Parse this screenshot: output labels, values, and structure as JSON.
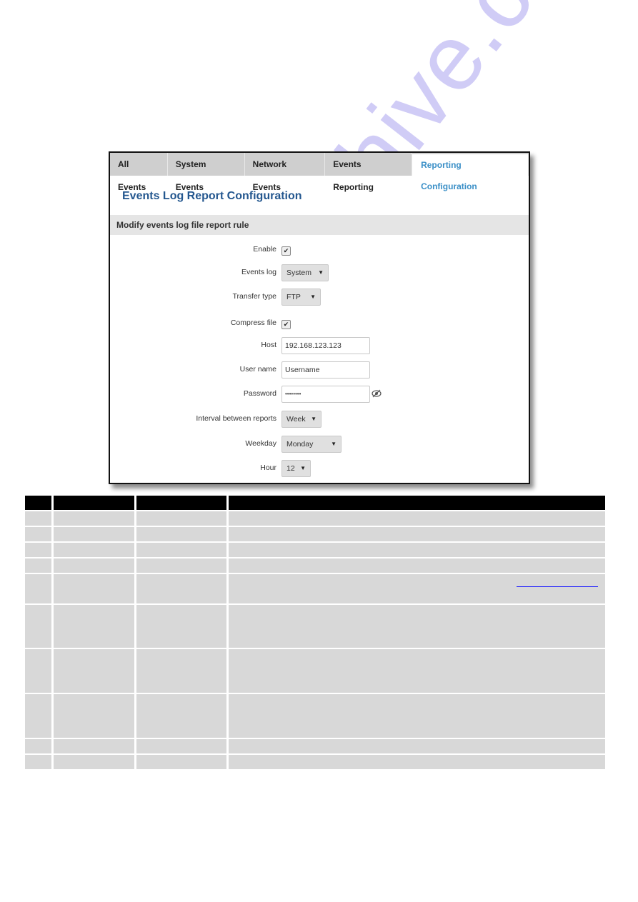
{
  "tabs": [
    {
      "label": "All Events",
      "active": false
    },
    {
      "label": "System Events",
      "active": false
    },
    {
      "label": "Network Events",
      "active": false
    },
    {
      "label": "Events Reporting",
      "active": false
    },
    {
      "label": "Reporting Configuration",
      "active": true
    }
  ],
  "page_title": "Events Log Report Configuration",
  "section_title": "Modify events log file report rule",
  "form": {
    "enable": {
      "label": "Enable",
      "checked": true
    },
    "events_log": {
      "label": "Events log",
      "value": "System"
    },
    "transfer_type": {
      "label": "Transfer type",
      "value": "FTP"
    },
    "compress_file": {
      "label": "Compress file",
      "checked": true
    },
    "host": {
      "label": "Host",
      "value": "192.168.123.123"
    },
    "user_name": {
      "label": "User name",
      "value": "Username"
    },
    "password": {
      "label": "Password",
      "value": "••••••••"
    },
    "interval": {
      "label": "Interval between reports",
      "value": "Week"
    },
    "weekday": {
      "label": "Weekday",
      "value": "Monday"
    },
    "hour": {
      "label": "Hour",
      "value": "12"
    }
  },
  "icons": {
    "check": "✔",
    "dropdown": "▼"
  },
  "colors": {
    "accent": "#3a8fc7",
    "title": "#24578f",
    "table_header": "#000000",
    "table_cell": "#d8d8d8"
  },
  "watermark": "manualshive.com"
}
